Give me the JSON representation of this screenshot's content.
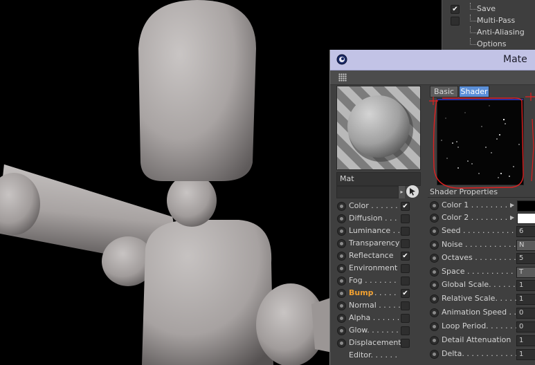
{
  "render_settings": {
    "items": [
      {
        "label": "Save",
        "checked": true
      },
      {
        "label": "Multi-Pass",
        "checked": false
      },
      {
        "label": "Anti-Aliasing",
        "checked": null
      },
      {
        "label": "Options",
        "checked": null
      }
    ]
  },
  "material_editor": {
    "title": "Mate",
    "material_name": "Mat",
    "channels": [
      {
        "label": "Color . . . . . .",
        "checked": true,
        "highlight": false
      },
      {
        "label": "Diffusion . . .",
        "checked": false,
        "highlight": false
      },
      {
        "label": "Luminance . .",
        "checked": false,
        "highlight": false
      },
      {
        "label": "Transparency",
        "checked": false,
        "highlight": false
      },
      {
        "label": "Reflectance",
        "checked": true,
        "highlight": false
      },
      {
        "label": "Environment",
        "checked": false,
        "highlight": false
      },
      {
        "label": "Fog . . . . . . .",
        "checked": false,
        "highlight": false
      },
      {
        "label": "Bump",
        "checked": true,
        "highlight": true
      },
      {
        "label": "Normal . . . . .",
        "checked": false,
        "highlight": false
      },
      {
        "label": "Alpha . . . . . .",
        "checked": false,
        "highlight": false
      },
      {
        "label": "Glow. . . . . . .",
        "checked": false,
        "highlight": false
      },
      {
        "label": "Displacement",
        "checked": false,
        "highlight": false
      },
      {
        "label": "Editor. . . . . .",
        "checked": null,
        "highlight": false
      }
    ],
    "tabs": [
      {
        "label": "Basic",
        "active": false
      },
      {
        "label": "Shader",
        "active": true
      }
    ],
    "shader_properties_header": "Shader Properties",
    "shader_properties": [
      {
        "label": "Color 1 . . . . . . . . .",
        "kind": "swatch",
        "value": "",
        "swatch_color": "#000000"
      },
      {
        "label": "Color 2 . . . . . . . . .",
        "kind": "swatch",
        "value": "",
        "swatch_color": "#ffffff"
      },
      {
        "label": "Seed . . . . . . . . . . . . .",
        "kind": "field",
        "value": "6"
      },
      {
        "label": "Noise . . . . . . . . . . . . .",
        "kind": "dropdown",
        "value": "N"
      },
      {
        "label": "Octaves . . . . . . . . . . .",
        "kind": "field",
        "value": "5"
      },
      {
        "label": "Space . . . . . . . . . . . . .",
        "kind": "dropdown",
        "value": "T"
      },
      {
        "label": "Global Scale. . . . . . . .",
        "kind": "field",
        "value": "1"
      },
      {
        "label": "Relative Scale. . . . . . .",
        "kind": "field",
        "value": "1"
      },
      {
        "label": "Animation Speed . . . .",
        "kind": "field",
        "value": "0"
      },
      {
        "label": "Loop Period. . . . . . . .",
        "kind": "field",
        "value": "0"
      },
      {
        "label": "Detail Attenuation",
        "kind": "field",
        "value": "1"
      },
      {
        "label": "Delta. . . . . . . . . . . . .",
        "kind": "field",
        "value": "1"
      }
    ]
  },
  "colors": {
    "titlebar": "#c2c3e6",
    "active_tab": "#5b8fd8",
    "bump_highlight": "#f0a030",
    "annotation": "#e02020"
  }
}
